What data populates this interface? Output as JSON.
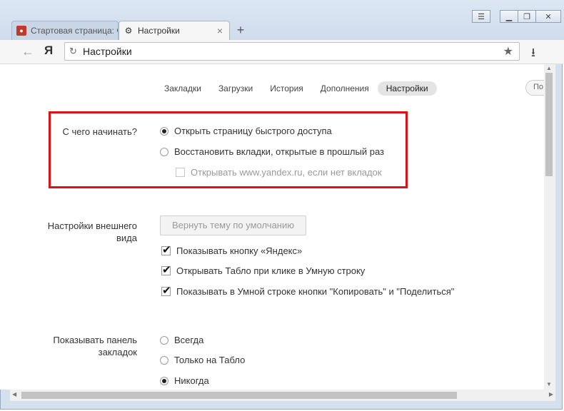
{
  "tabs": [
    {
      "label": "Стартовая страница: чт",
      "icon": "yandex-favicon-icon",
      "close": "×"
    },
    {
      "label": "Настройки",
      "icon": "gear-icon",
      "close": "×"
    }
  ],
  "new_tab": "+",
  "toolbar": {
    "back": "←",
    "yandex_logo": "Я",
    "address": "Настройки",
    "reload": "↻",
    "star": "★",
    "download": "⭳"
  },
  "nav": {
    "items": [
      "Закладки",
      "Загрузки",
      "История",
      "Дополнения",
      "Настройки"
    ],
    "active": "Настройки",
    "cut_button": "По"
  },
  "startup": {
    "label": "С чего начинать?",
    "options": [
      {
        "label": "Открыть страницу быстрого доступа",
        "checked": true
      },
      {
        "label": "Восстановить вкладки, открытые в прошлый раз",
        "checked": false
      }
    ],
    "sub_option": {
      "label": "Открывать www.yandex.ru, если нет вкладок",
      "checked": false,
      "disabled": true
    }
  },
  "appearance": {
    "label_line1": "Настройки внешнего",
    "label_line2": "вида",
    "reset_button": "Вернуть тему по умолчанию",
    "checks": [
      {
        "label": "Показывать кнопку «Яндекс»",
        "checked": true
      },
      {
        "label": "Открывать Табло при клике в Умную строку",
        "checked": true
      },
      {
        "label": "Показывать в Умной строке кнопки \"Копировать\" и \"Поделиться\"",
        "checked": true
      }
    ]
  },
  "bookmarks_bar": {
    "label_line1": "Показывать панель",
    "label_line2": "закладок",
    "options": [
      {
        "label": "Всегда",
        "checked": false
      },
      {
        "label": "Только на Табло",
        "checked": false
      },
      {
        "label": "Никогда",
        "checked": true
      }
    ]
  },
  "colors": {
    "highlight": "#d8141a"
  }
}
